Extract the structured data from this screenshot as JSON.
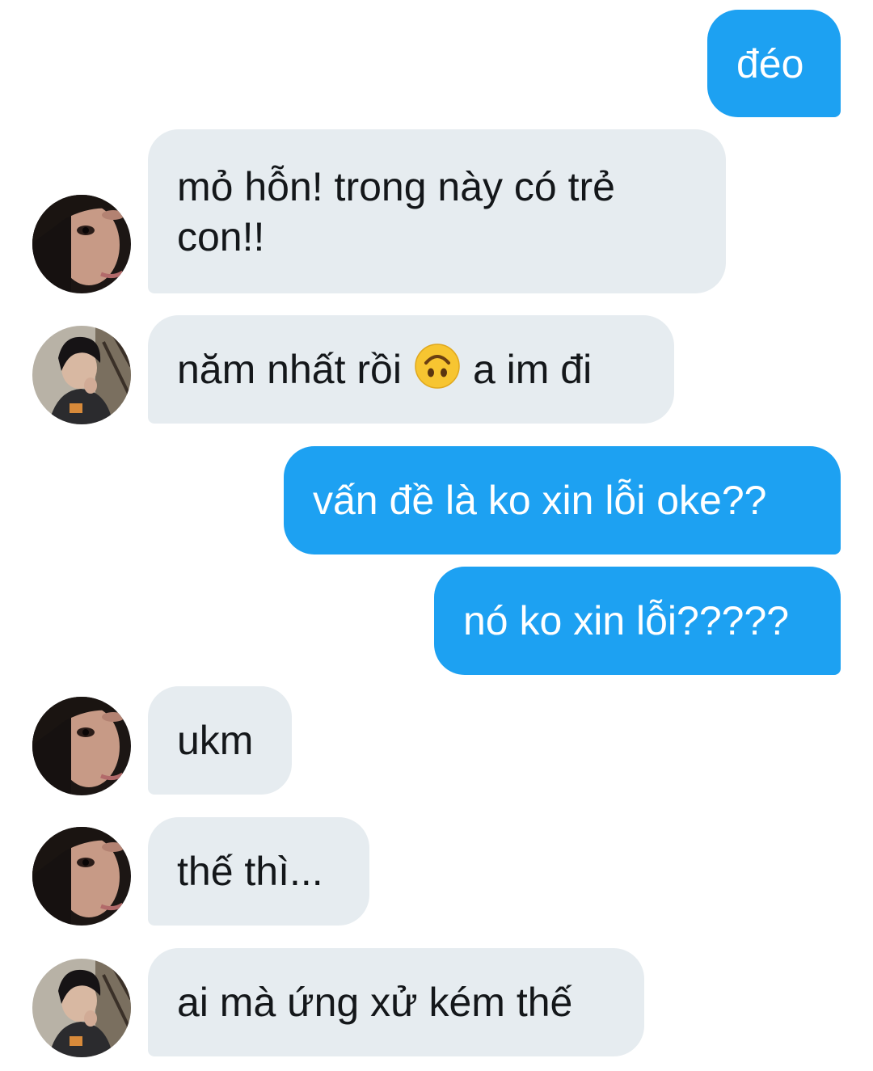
{
  "conversation": {
    "messages": [
      {
        "direction": "outgoing",
        "text": "đéo"
      },
      {
        "direction": "incoming",
        "avatar": "hooded-avatar",
        "text": "mỏ hỗn! trong này có trẻ con!!"
      },
      {
        "direction": "incoming",
        "avatar": "photo-avatar",
        "text_before": "năm nhất rồi",
        "emoji": "upside-down-face-emoji",
        "text_after": "a im đi"
      },
      {
        "direction": "outgoing",
        "text": "vấn đề là ko xin lỗi oke??"
      },
      {
        "direction": "outgoing",
        "text": "nó ko xin lỗi?????"
      },
      {
        "direction": "incoming",
        "avatar": "hooded-avatar",
        "text": "ukm"
      },
      {
        "direction": "incoming",
        "avatar": "hooded-avatar",
        "text": "thế thì..."
      },
      {
        "direction": "incoming",
        "avatar": "photo-avatar",
        "text": "ai mà ứng xử kém thế"
      }
    ]
  },
  "colors": {
    "outgoing_bubble": "#1da1f2",
    "incoming_bubble": "#e6ecf0",
    "incoming_text": "#14171a",
    "outgoing_text": "#ffffff"
  }
}
